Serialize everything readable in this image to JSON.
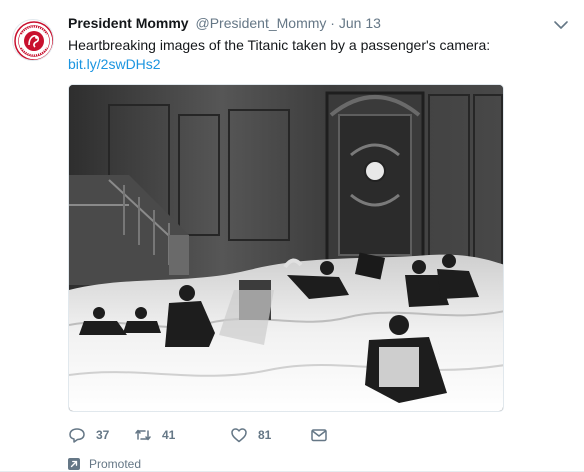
{
  "tweet": {
    "display_name": "President Mommy",
    "handle": "@President_Mommy",
    "separator": "·",
    "time": "Jun 13",
    "text": "Heartbreaking images of the Titanic taken by a passenger's camera:",
    "link": "bit.ly/2swDHs2",
    "avatar_icon": "president-mommy-seal-logo",
    "avatar_logo_text": "PRESIDENT MOMMY"
  },
  "actions": {
    "reply_count": "37",
    "retweet_count": "41",
    "like_count": "81"
  },
  "promoted": {
    "label": "Promoted"
  },
  "colors": {
    "link": "#1b95e0",
    "secondary_text": "#657786",
    "avatar_red": "#c8102e"
  }
}
